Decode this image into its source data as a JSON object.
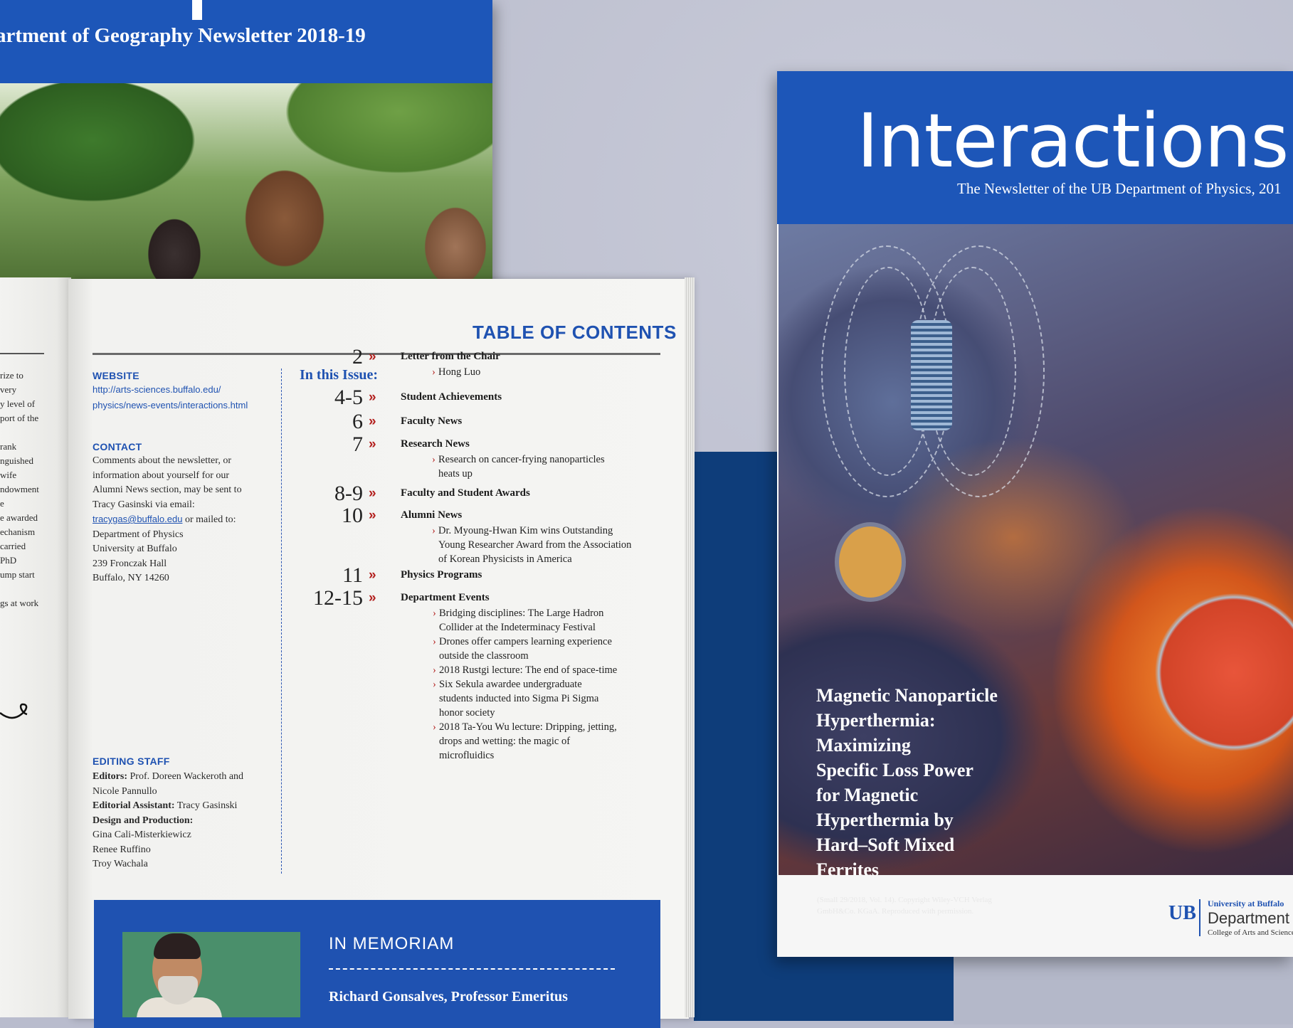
{
  "geography": {
    "title": "artment of Geography Newsletter 2018-19"
  },
  "left_page": {
    "lines": [
      "rize to",
      "very",
      "y level of",
      "port of the",
      "",
      "rank",
      "nguished",
      "wife",
      "ndowment",
      "e",
      "e awarded",
      "echanism",
      "carried",
      "PhD",
      "ump start",
      "",
      "gs at work"
    ]
  },
  "toc": {
    "heading": "TABLE OF CONTENTS",
    "website_label": "WEBSITE",
    "website_url_1": "http://arts-sciences.buffalo.edu/",
    "website_url_2": "physics/news-events/interactions.html",
    "contact_label": "CONTACT",
    "contact_lines": [
      "Comments about the newsletter, or",
      "information about yourself for our",
      "Alumni News section, may be sent to",
      "Tracy Gasinski via email:"
    ],
    "contact_email": "tracygas@buffalo.edu",
    "contact_email_suffix": " or mailed to:",
    "address": [
      "Department of Physics",
      "University at Buffalo",
      "239 Fronczak Hall",
      "Buffalo, NY 14260"
    ],
    "staff_label": "EDITING STAFF",
    "editors_label": "Editors:",
    "editors_1": " Prof. Doreen Wackeroth and",
    "editors_2": "Nicole Pannullo",
    "assistant_label": "Editorial Assistant:",
    "assistant": " Tracy Gasinski",
    "design_label": "Design and Production:",
    "design": [
      "Gina Cali-Misterkiewicz",
      "Renee Ruffino",
      "Troy Wachala"
    ],
    "in_this_issue": "In this Issue:",
    "entries": [
      {
        "num": "2",
        "label": "Letter from the Chair",
        "subs": [
          "Hong Luo"
        ]
      },
      {
        "num": "4-5",
        "label": "Student Achievements",
        "subs": []
      },
      {
        "num": "6",
        "label": "Faculty News",
        "subs": []
      },
      {
        "num": "7",
        "label": "Research News",
        "subs": [
          "Research on cancer-frying nanoparticles",
          "heats up"
        ]
      },
      {
        "num": "8-9",
        "label": "Faculty and Student Awards",
        "subs": []
      },
      {
        "num": "10",
        "label": "Alumni News",
        "subs": [
          "Dr. Myoung-Hwan Kim wins Outstanding",
          "Young Researcher Award from the Association",
          "of Korean Physicists in America"
        ]
      },
      {
        "num": "11",
        "label": "Physics Programs",
        "subs": []
      },
      {
        "num": "12-15",
        "label": "Department Events",
        "subs": [
          "Bridging disciplines: The Large Hadron",
          "Collider at the Indeterminacy Festival",
          "Drones offer campers learning experience",
          "outside the classroom",
          "2018 Rustgi lecture: The end of space-time",
          "Six Sekula awardee undergraduate",
          "students inducted into Sigma Pi Sigma",
          "honor society",
          "2018 Ta-You Wu lecture: Dripping, jetting,",
          "drops and wetting:  the magic of",
          "microfluidics"
        ]
      }
    ],
    "arrow": "»",
    "memoriam_title": "IN MEMORIAM",
    "memoriam_name": "Richard Gonsalves, Professor Emeritus"
  },
  "cover": {
    "title": "Interactions",
    "subtitle": "The Newsletter of the UB Department of Physics, 201",
    "headline": [
      "Magnetic Nanoparticle",
      "Hyperthermia:",
      "Maximizing",
      "Specific Loss Power",
      "for Magnetic",
      "Hyperthermia by",
      "Hard–Soft Mixed",
      "Ferrites"
    ],
    "credit_1": "(Small 29/2018, Vol. 14). Copyright Wiley-VCH Verlag",
    "credit_2": "GmbH&Co. KGaA. Reproduced with permission.",
    "ub_mark": "UB",
    "ub_university": "University at Buffalo",
    "ub_department": "Department of",
    "ub_college": "College of Arts and Science"
  }
}
